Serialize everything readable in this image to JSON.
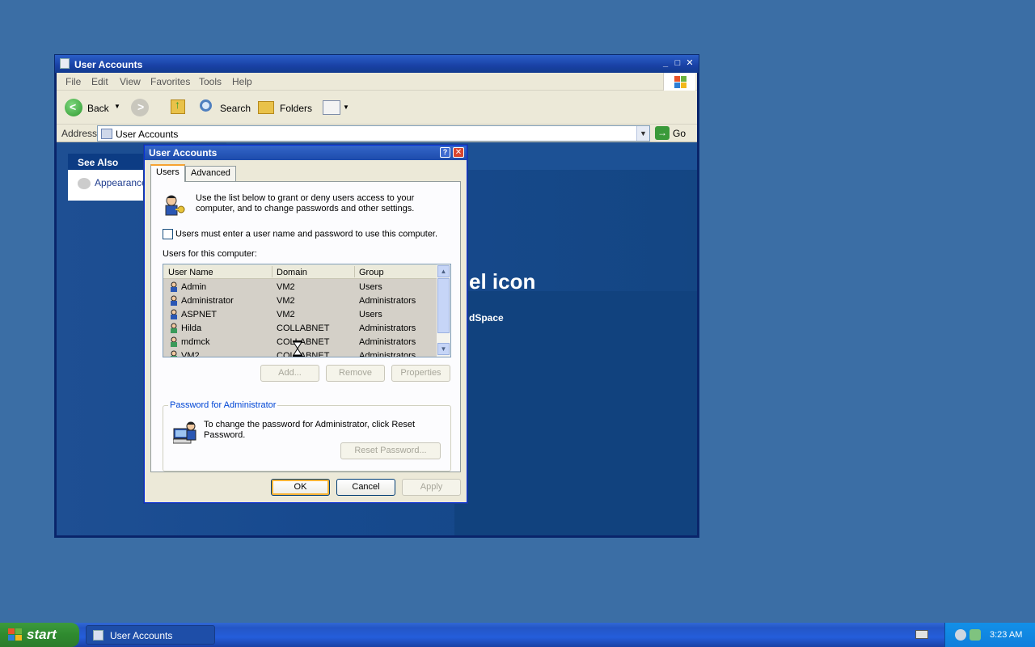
{
  "explorer": {
    "title": "User Accounts",
    "menu": [
      "File",
      "Edit",
      "View",
      "Favorites",
      "Tools",
      "Help"
    ],
    "toolbar": {
      "back": "Back",
      "search": "Search",
      "folders": "Folders"
    },
    "address": {
      "label": "Address",
      "value": "User Accounts",
      "go": "Go"
    },
    "see_also": {
      "header": "See Also",
      "item": "Appearance"
    },
    "background_text_large": "el icon",
    "background_text_small": "dSpace"
  },
  "dialog": {
    "title": "User Accounts",
    "help_glyph": "?",
    "close_glyph": "✕",
    "tabs": [
      "Users",
      "Advanced"
    ],
    "active_tab": "Users",
    "intro": "Use the list below to grant or deny users access to your computer, and to change passwords and other settings.",
    "checkbox_label": "Users must enter a user name and password to use this computer.",
    "checkbox_checked": false,
    "users_label": "Users for this computer:",
    "columns": [
      "User Name",
      "Domain",
      "Group"
    ],
    "rows": [
      {
        "name": "Admin",
        "domain": "VM2",
        "group": "Users"
      },
      {
        "name": "Administrator",
        "domain": "VM2",
        "group": "Administrators"
      },
      {
        "name": "ASPNET",
        "domain": "VM2",
        "group": "Users"
      },
      {
        "name": "Hilda",
        "domain": "COLLABNET",
        "group": "Administrators"
      },
      {
        "name": "mdmck",
        "domain": "COLLABNET",
        "group": "Administrators"
      },
      {
        "name": "VM2",
        "domain": "COLLABNET",
        "group": "Administrators"
      }
    ],
    "list_buttons": {
      "add": "Add...",
      "remove": "Remove",
      "properties": "Properties"
    },
    "password_group": {
      "legend": "Password for Administrator",
      "text": "To change the password for Administrator, click Reset Password.",
      "button": "Reset Password..."
    },
    "buttons": {
      "ok": "OK",
      "cancel": "Cancel",
      "apply": "Apply"
    }
  },
  "taskbar": {
    "start": "start",
    "task": "User Accounts",
    "clock": "3:23 AM"
  }
}
